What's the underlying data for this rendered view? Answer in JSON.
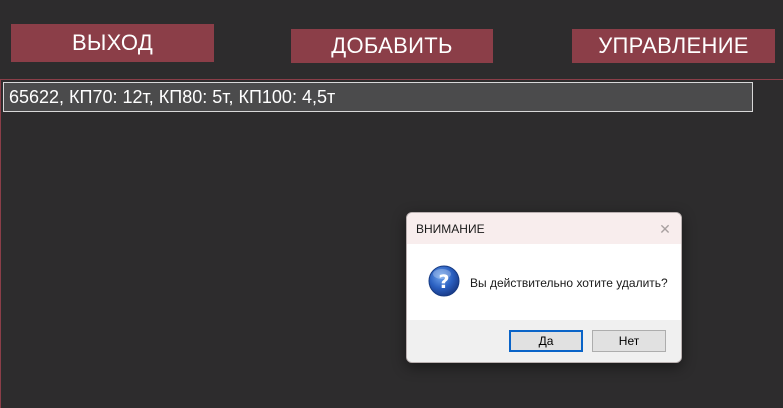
{
  "toolbar": {
    "exit_label": "ВЫХОД",
    "add_label": "ДОБАВИТЬ",
    "manage_label": "УПРАВЛЕНИЕ"
  },
  "list": {
    "items": [
      {
        "text": "65622, КП70: 12т, КП80: 5т, КП100: 4,5т"
      }
    ]
  },
  "dialog": {
    "title": "ВНИМАНИЕ",
    "close_icon": "close-icon",
    "icon": "question-icon",
    "message": "Вы действительно хотите удалить?",
    "yes_label": "Да",
    "no_label": "Нет"
  },
  "colors": {
    "background": "#2d2c2d",
    "accent": "#8b3e48",
    "list_item_bg": "#4b4b4c"
  }
}
